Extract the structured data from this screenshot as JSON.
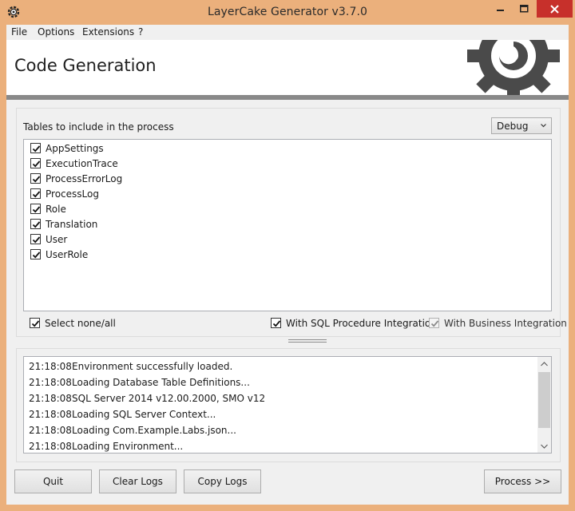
{
  "window": {
    "title": "LayerCake Generator v3.7.0",
    "accent": "#ebb07c",
    "close_color": "#c7302b"
  },
  "menu": {
    "items": [
      "File",
      "Options",
      "Extensions",
      "?"
    ]
  },
  "header": {
    "title": "Code Generation",
    "logo_icon": "gear-logo-icon"
  },
  "tables": {
    "label": "Tables to include in the process",
    "config": {
      "selected": "Debug"
    },
    "items": [
      {
        "label": "AppSettings",
        "checked": true
      },
      {
        "label": "ExecutionTrace",
        "checked": true
      },
      {
        "label": "ProcessErrorLog",
        "checked": true
      },
      {
        "label": "ProcessLog",
        "checked": true
      },
      {
        "label": "Role",
        "checked": true
      },
      {
        "label": "Translation",
        "checked": true
      },
      {
        "label": "User",
        "checked": true
      },
      {
        "label": "UserRole",
        "checked": true
      }
    ]
  },
  "options": {
    "select_all": {
      "label": "Select none/all",
      "checked": true
    },
    "sql_integration": {
      "label": "With SQL Procedure Integration",
      "checked": true
    },
    "business_integration": {
      "label": "With Business Integration",
      "checked": true,
      "enabled": false
    }
  },
  "log": {
    "entries": [
      {
        "time": "21:18:08",
        "message": "Environment successfully loaded."
      },
      {
        "time": "21:18:08",
        "message": "Loading Database Table Definitions..."
      },
      {
        "time": "21:18:08",
        "message": "SQL Server 2014 v12.00.2000, SMO v12"
      },
      {
        "time": "21:18:08",
        "message": "Loading SQL Server Context..."
      },
      {
        "time": "21:18:08",
        "message": "Loading Com.Example.Labs.json..."
      },
      {
        "time": "21:18:08",
        "message": "Loading Environment..."
      }
    ]
  },
  "buttons": {
    "quit": "Quit",
    "clear_logs": "Clear Logs",
    "copy_logs": "Copy Logs",
    "process": "Process >>"
  }
}
